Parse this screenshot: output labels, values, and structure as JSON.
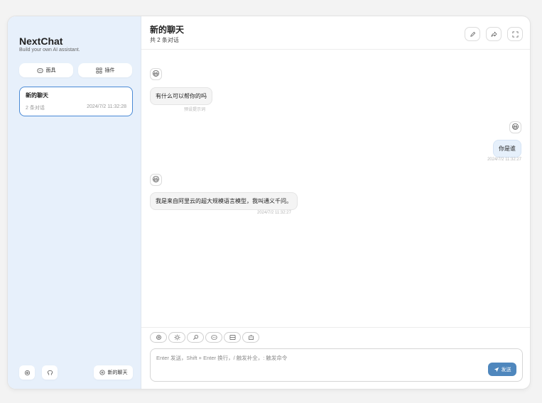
{
  "sidebar": {
    "title": "NextChat",
    "subtitle": "Build your own AI assistant.",
    "mask_button": "面具",
    "plugin_button": "插件",
    "chat_item": {
      "title": "新的聊天",
      "count": "2 条对话",
      "time": "2024/7/2 11:32:28"
    },
    "new_chat_button": "新的聊天"
  },
  "header": {
    "title": "新的聊天",
    "subtitle": "共 2 条对话"
  },
  "messages": [
    {
      "role": "bot",
      "text": "有什么可以帮你的吗",
      "meta": "预设提示词"
    },
    {
      "role": "user",
      "text": "你是谁",
      "meta": "2024/7/2 11:32:27"
    },
    {
      "role": "bot",
      "text": "我是来自阿里云的超大规模语言模型，我叫通义千问。",
      "meta": "2024/7/2 11:32:27"
    }
  ],
  "input": {
    "placeholder": "Enter 发送，Shift + Enter 换行，/ 触发补全，: 触发命令",
    "send_label": "发送"
  },
  "colors": {
    "accent": "#4f87bd",
    "sidebar_bg": "#e7f0fb",
    "selected_border": "#4a8ad6"
  }
}
